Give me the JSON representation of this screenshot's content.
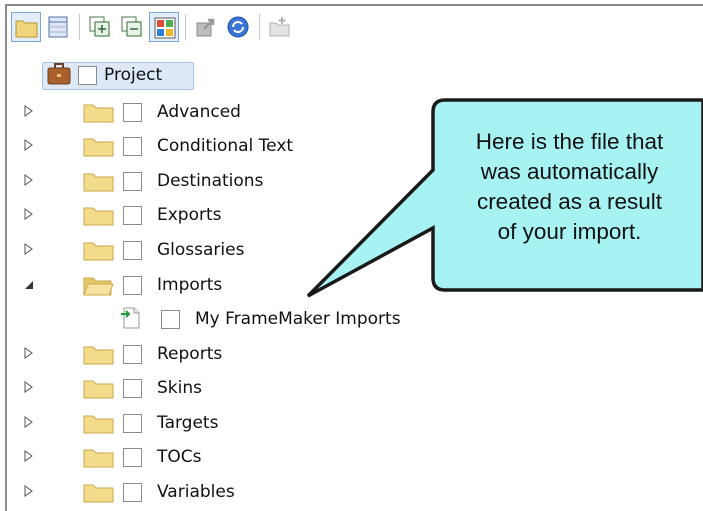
{
  "toolbar": {
    "buttons": [
      {
        "icon": "open-folder-icon",
        "selected": true
      },
      {
        "icon": "list-view-icon",
        "selected": false
      },
      {
        "icon": "expand-all-icon",
        "selected": false
      },
      {
        "icon": "collapse-all-icon",
        "selected": false
      },
      {
        "icon": "grid-view-icon",
        "selected": true
      },
      {
        "icon": "export-icon",
        "selected": false
      },
      {
        "icon": "refresh-icon",
        "selected": false
      },
      {
        "icon": "new-item-icon",
        "selected": false
      }
    ]
  },
  "tree": {
    "root": {
      "label": "Project",
      "icon": "briefcase-icon"
    },
    "items": [
      {
        "label": "Advanced",
        "expanded": false
      },
      {
        "label": "Conditional Text",
        "expanded": false
      },
      {
        "label": "Destinations",
        "expanded": false
      },
      {
        "label": "Exports",
        "expanded": false
      },
      {
        "label": "Glossaries",
        "expanded": false
      },
      {
        "label": "Imports",
        "expanded": true
      },
      {
        "label": "My FrameMaker Imports",
        "child": true
      },
      {
        "label": "Reports",
        "expanded": false
      },
      {
        "label": "Skins",
        "expanded": false
      },
      {
        "label": "Targets",
        "expanded": false
      },
      {
        "label": "TOCs",
        "expanded": false
      },
      {
        "label": "Variables",
        "expanded": false
      }
    ]
  },
  "callout": {
    "lines": [
      "Here is the file that",
      "was automatically",
      "created as a result",
      "of your import."
    ],
    "fill": "#a7f3f3",
    "border": "#1a1a1a"
  },
  "colors": {
    "folder": "#f3dc8c",
    "selection": "#dde9f7"
  }
}
